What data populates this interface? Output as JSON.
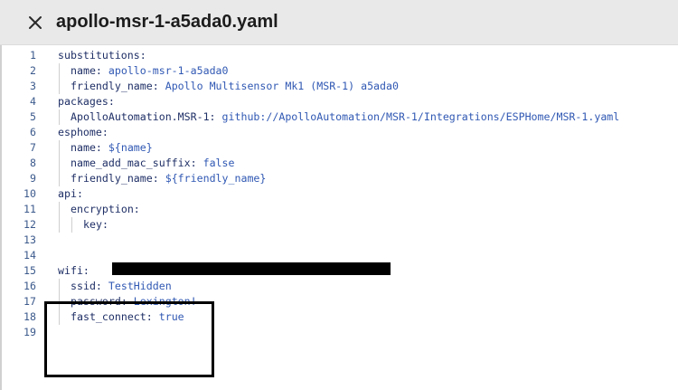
{
  "header": {
    "title": "apollo-msr-1-a5ada0.yaml",
    "close_icon": "close-icon"
  },
  "editor": {
    "line_numbers": [
      "1",
      "2",
      "3",
      "4",
      "5",
      "6",
      "7",
      "8",
      "9",
      "10",
      "11",
      "12",
      "13",
      "14",
      "15",
      "16",
      "17",
      "18",
      "19"
    ],
    "lines": [
      {
        "indent": 0,
        "key": "substitutions:",
        "value": ""
      },
      {
        "indent": 1,
        "key": "name:",
        "value": " apollo-msr-1-a5ada0"
      },
      {
        "indent": 1,
        "key": "friendly_name:",
        "value": " Apollo Multisensor Mk1 (MSR-1) a5ada0"
      },
      {
        "indent": 0,
        "key": "packages:",
        "value": ""
      },
      {
        "indent": 1,
        "key": "ApolloAutomation.MSR-1:",
        "value": " github://ApolloAutomation/MSR-1/Integrations/ESPHome/MSR-1.yaml"
      },
      {
        "indent": 0,
        "key": "esphome:",
        "value": ""
      },
      {
        "indent": 1,
        "key": "name:",
        "value": " ${name}"
      },
      {
        "indent": 1,
        "key": "name_add_mac_suffix:",
        "value": " false"
      },
      {
        "indent": 1,
        "key": "friendly_name:",
        "value": " ${friendly_name}"
      },
      {
        "indent": 0,
        "key": "api:",
        "value": ""
      },
      {
        "indent": 1,
        "key": "encryption:",
        "value": ""
      },
      {
        "indent": 2,
        "key": "key:",
        "value": ""
      },
      {
        "indent": 0,
        "key": "",
        "value": ""
      },
      {
        "indent": 0,
        "key": "",
        "value": ""
      },
      {
        "indent": 0,
        "key": "wifi:",
        "value": ""
      },
      {
        "indent": 1,
        "key": "ssid:",
        "value": " TestHidden"
      },
      {
        "indent": 1,
        "key": "password:",
        "value": " Lexington!"
      },
      {
        "indent": 1,
        "key": "fast_connect:",
        "value": " true"
      },
      {
        "indent": 0,
        "key": "",
        "value": ""
      }
    ]
  },
  "colors": {
    "key": "#1f2f66",
    "value": "#3058b3",
    "line_number": "#3c5a8c",
    "redaction": "#000000",
    "highlight_border": "#000000"
  }
}
